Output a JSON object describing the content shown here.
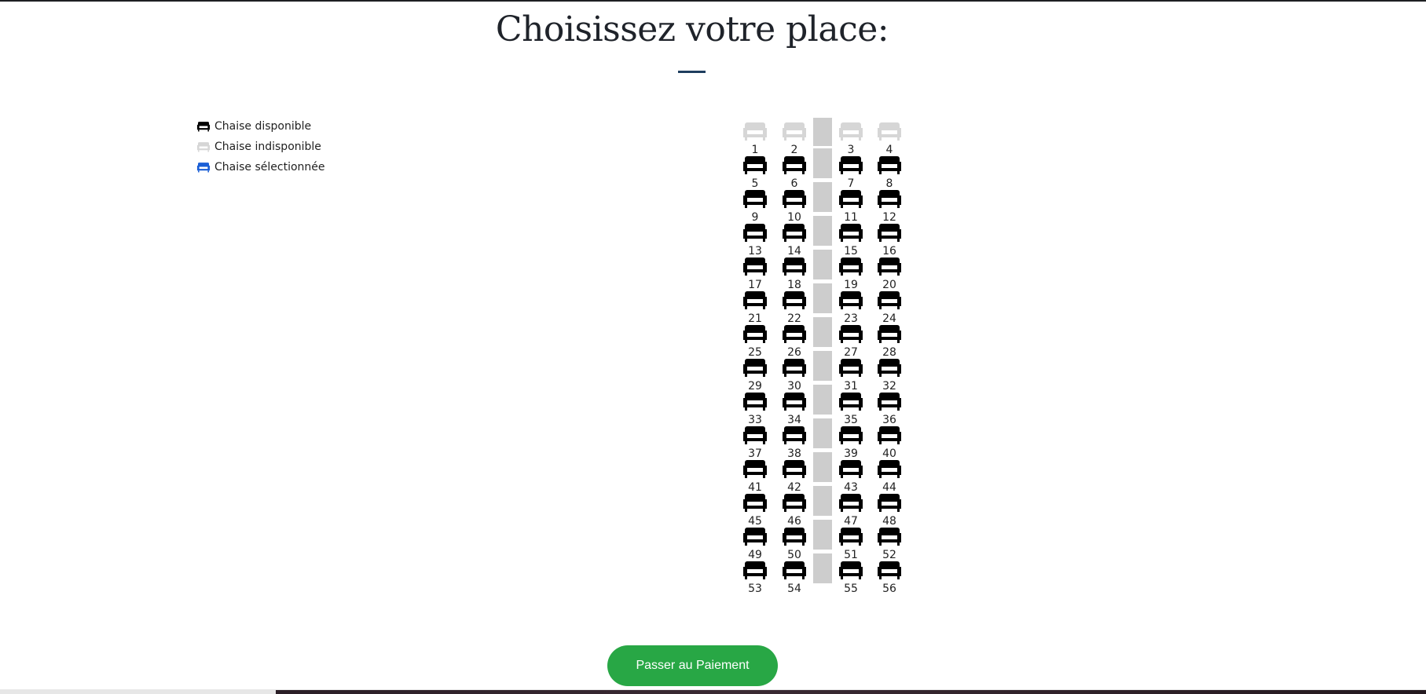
{
  "title": "Choisissez votre place:",
  "legend": {
    "available": "Chaise disponible",
    "unavailable": "Chaise indisponible",
    "selected": "Chaise sélectionnée"
  },
  "colors": {
    "available": "#000000",
    "unavailable": "#d6d6d6",
    "selected": "#1a5fd6",
    "button": "#28a745",
    "aisle": "#cdcdcd"
  },
  "seats": {
    "columns": 4,
    "numbers": [
      1,
      2,
      3,
      4,
      5,
      6,
      7,
      8,
      9,
      10,
      11,
      12,
      13,
      14,
      15,
      16,
      17,
      18,
      19,
      20,
      21,
      22,
      23,
      24,
      25,
      26,
      27,
      28,
      29,
      30,
      31,
      32,
      33,
      34,
      35,
      36,
      37,
      38,
      39,
      40,
      41,
      42,
      43,
      44,
      45,
      46,
      47,
      48,
      49,
      50,
      51,
      52,
      53,
      54,
      55,
      56
    ],
    "unavailable_rows": [
      0
    ]
  },
  "pay_button": "Passer au Paiement"
}
